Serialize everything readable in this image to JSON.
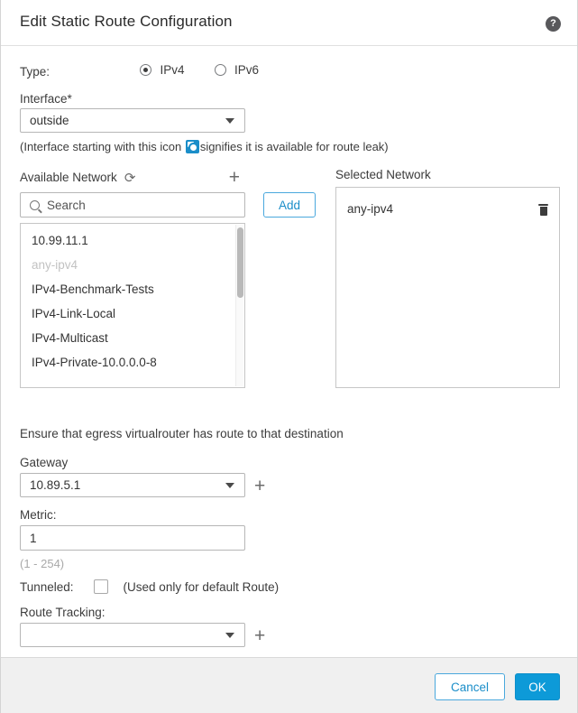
{
  "header": {
    "title": "Edit Static Route Configuration",
    "help_icon": "question-mark-circle-icon",
    "help_label": "?"
  },
  "form": {
    "type_label": "Type:",
    "type_options": [
      {
        "label": "IPv4",
        "selected": true
      },
      {
        "label": "IPv6",
        "selected": false
      }
    ],
    "interface_label": "Interface*",
    "interface_value": "outside",
    "route_leak_note_before": "(Interface starting with this icon ",
    "route_leak_icon": "route-leak-icon",
    "route_leak_note_after": "signifies it is available for route leak)",
    "egress_note": "Ensure that egress virtualrouter has route to that destination",
    "gateway_label": "Gateway",
    "gateway_value": "10.89.5.1",
    "metric_label": "Metric:",
    "metric_value": "1",
    "metric_hint": "(1 - 254)",
    "tunneled_label": "Tunneled:",
    "tunneled_checked": false,
    "tunneled_note": "(Used only for default Route)",
    "route_tracking_label": "Route Tracking:",
    "route_tracking_value": ""
  },
  "available_network": {
    "title": "Available Network",
    "refresh_icon": "refresh-icon",
    "add_new_icon": "plus-icon",
    "search_placeholder": "Search",
    "search_icon": "search-icon",
    "items": [
      {
        "label": "10.99.11.1",
        "disabled": false
      },
      {
        "label": "any-ipv4",
        "disabled": true
      },
      {
        "label": "IPv4-Benchmark-Tests",
        "disabled": false
      },
      {
        "label": "IPv4-Link-Local",
        "disabled": false
      },
      {
        "label": "IPv4-Multicast",
        "disabled": false
      },
      {
        "label": "IPv4-Private-10.0.0.0-8",
        "disabled": false
      }
    ]
  },
  "add_button": {
    "label": "Add"
  },
  "selected_network": {
    "title": "Selected Network",
    "items": [
      {
        "label": "any-ipv4",
        "delete_icon": "trash-icon"
      }
    ]
  },
  "footer": {
    "cancel_label": "Cancel",
    "ok_label": "OK"
  },
  "colors": {
    "accent_blue": "#0d9ad8",
    "link_blue": "#1b8ec9",
    "footer_bg": "#f0f0f0",
    "border_grey": "#c6c6c6"
  }
}
